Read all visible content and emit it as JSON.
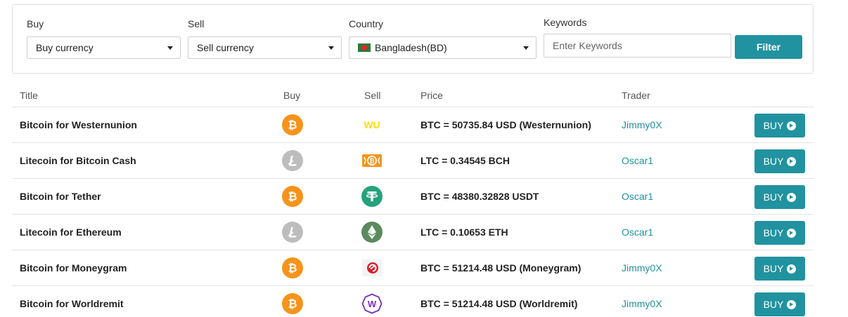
{
  "filters": {
    "buy_label": "Buy",
    "buy_value": "Buy currency",
    "sell_label": "Sell",
    "sell_value": "Sell currency",
    "country_label": "Country",
    "country_value": "Bangladesh(BD)",
    "keywords_label": "Keywords",
    "keywords_placeholder": "Enter Keywords",
    "filter_button": "Filter"
  },
  "table": {
    "headers": {
      "title": "Title",
      "buy": "Buy",
      "sell": "Sell",
      "price": "Price",
      "trader": "Trader"
    },
    "buy_button_label": "BUY",
    "rows": [
      {
        "title": "Bitcoin for Westernunion",
        "buy_icon": "bitcoin-icon",
        "sell_icon": "westernunion-icon",
        "price": "BTC = 50735.84 USD (Westernunion)",
        "trader": "Jimmy0X"
      },
      {
        "title": "Litecoin for Bitcoin Cash",
        "buy_icon": "litecoin-icon",
        "sell_icon": "bitcoin-cash-icon",
        "price": "LTC = 0.34545 BCH",
        "trader": "Oscar1"
      },
      {
        "title": "Bitcoin for Tether",
        "buy_icon": "bitcoin-icon",
        "sell_icon": "tether-icon",
        "price": "BTC = 48380.32828 USDT",
        "trader": "Oscar1"
      },
      {
        "title": "Litecoin for Ethereum",
        "buy_icon": "litecoin-icon",
        "sell_icon": "ethereum-icon",
        "price": "LTC = 0.10653 ETH",
        "trader": "Oscar1"
      },
      {
        "title": "Bitcoin for Moneygram",
        "buy_icon": "bitcoin-icon",
        "sell_icon": "moneygram-icon",
        "price": "BTC = 51214.48 USD (Moneygram)",
        "trader": "Jimmy0X"
      },
      {
        "title": "Bitcoin for Worldremit",
        "buy_icon": "bitcoin-icon",
        "sell_icon": "worldremit-icon",
        "price": "BTC = 51214.48 USD (Worldremit)",
        "trader": "Jimmy0X"
      }
    ]
  },
  "icon_text": {
    "westernunion": "WU",
    "worldremit": "W"
  },
  "colors": {
    "accent": "#21929f",
    "bitcoin": "#f7931a",
    "litecoin": "#bdbdbd",
    "tether": "#26a17b",
    "ethereum": "#5b8a5e",
    "westernunion": "#ffdd00",
    "moneygram": "#d8202a",
    "worldremit": "#7a2cbf"
  }
}
